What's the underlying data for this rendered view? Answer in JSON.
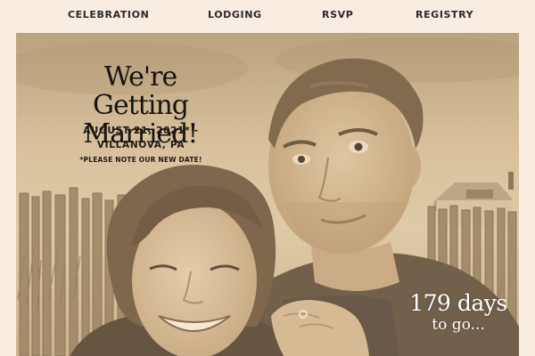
{
  "nav": {
    "items": [
      "CELEBRATION",
      "LODGING",
      "RSVP",
      "REGISTRY"
    ]
  },
  "hero": {
    "headline": "We're Getting Married!",
    "date": "AUGUST 21, 2021* -",
    "location": "VILLANOVA, PA",
    "note": "*PLEASE NOTE OUR NEW DATE!",
    "countdown_days": "179 days",
    "countdown_suffix": "to go..."
  },
  "colors": {
    "background": "#f9ece0",
    "photo_tone": "#cdb693",
    "text": "#2a2a2a",
    "countdown_text": "#ffffff"
  }
}
